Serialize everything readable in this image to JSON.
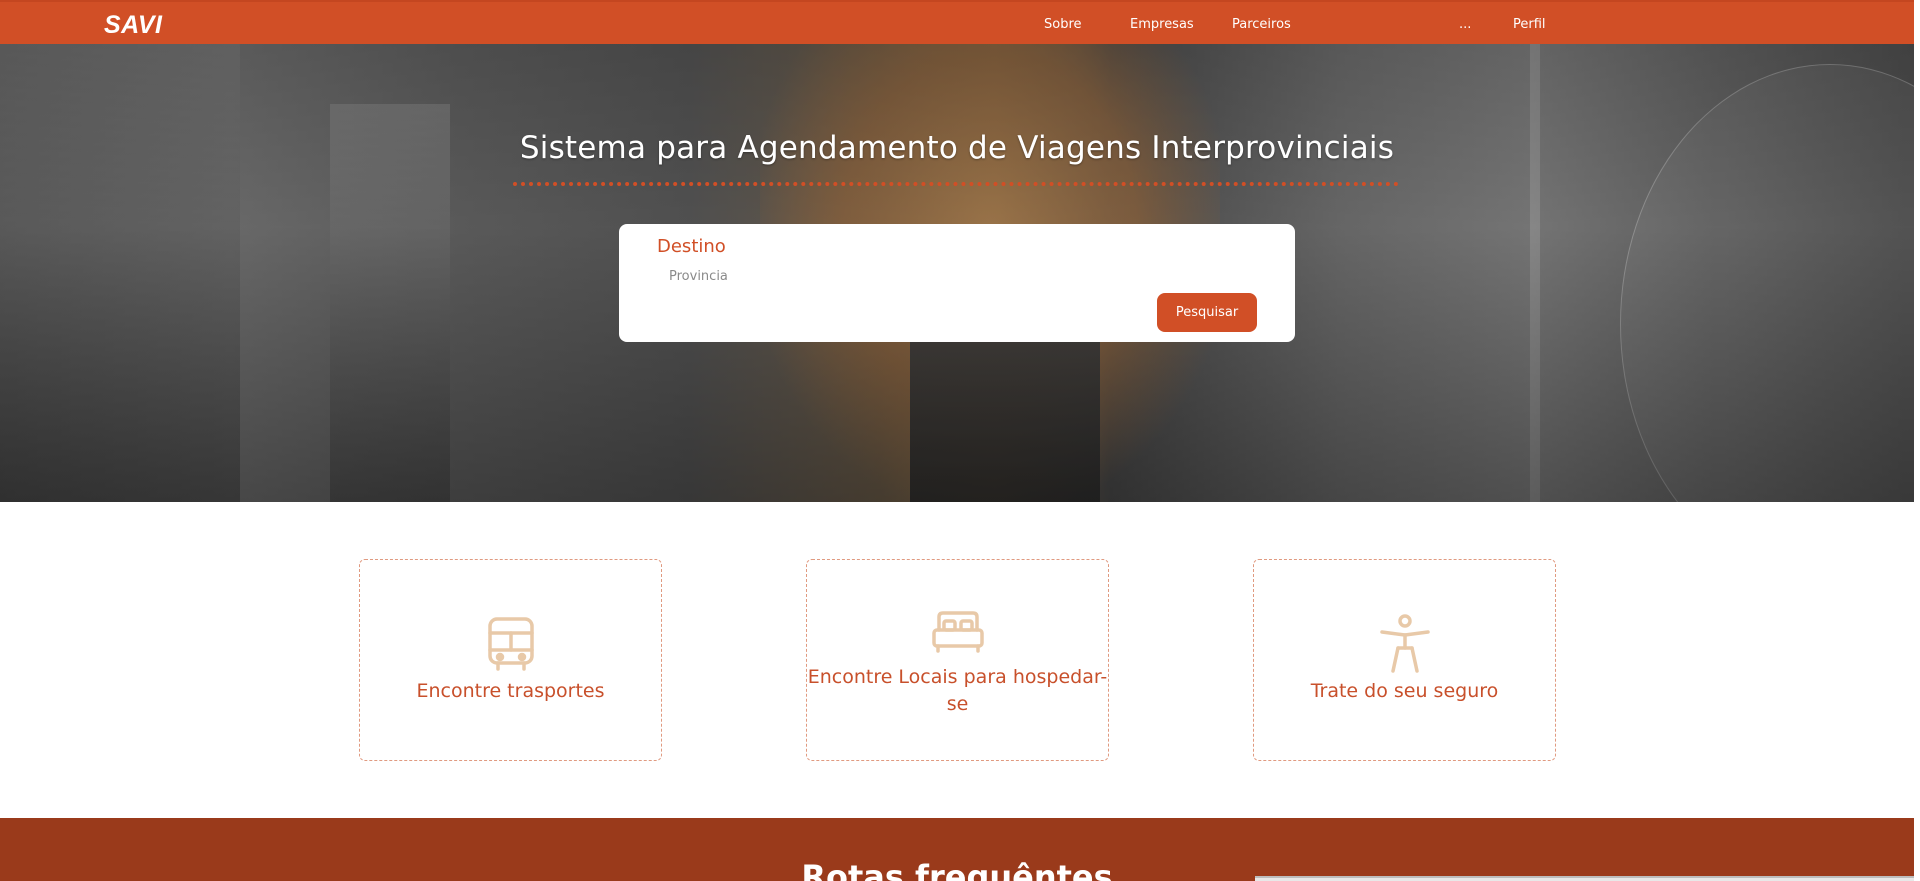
{
  "brand": {
    "logo": "SAVI"
  },
  "nav": {
    "items": [
      "Sobre",
      "Empresas",
      "Parceiros",
      "...",
      "Perfil"
    ]
  },
  "hero": {
    "title": "Sistema para Agendamento de Viagens Interprovinciais",
    "search": {
      "label": "Destino",
      "placeholder": "Provincia",
      "button": "Pesquisar"
    }
  },
  "features": [
    {
      "icon": "bus-icon",
      "label": "Encontre trasportes"
    },
    {
      "icon": "bed-icon",
      "label": "Encontre Locais para hospedar-se"
    },
    {
      "icon": "accessibility-icon",
      "label": "Trate do seu seguro"
    }
  ],
  "section": {
    "title": "Rotas frequêntes"
  },
  "colors": {
    "primary": "#d14f26",
    "dark": "#9a3a1b",
    "icon": "#e8c9a8"
  }
}
